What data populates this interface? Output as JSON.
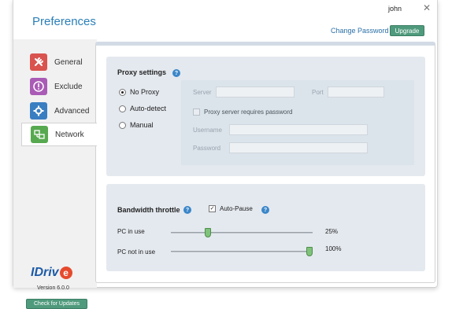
{
  "window": {
    "title": "Preferences",
    "user": "john",
    "close_glyph": "✕",
    "change_password": "Change Password",
    "upgrade": "Upgrade"
  },
  "sidebar": {
    "items": [
      {
        "label": "General",
        "icon": "wrench-icon",
        "color": "#d9534f",
        "active": false
      },
      {
        "label": "Exclude",
        "icon": "exclamation-icon",
        "color": "#a95bb5",
        "active": false
      },
      {
        "label": "Advanced",
        "icon": "gear-icon",
        "color": "#3a7ec2",
        "active": false
      },
      {
        "label": "Network",
        "icon": "network-icon",
        "color": "#57a94f",
        "active": true
      }
    ],
    "brand": "IDriv",
    "brand_e": "e",
    "version": "Version 6.0.0",
    "check_updates": "Check for Updates"
  },
  "proxy": {
    "title": "Proxy settings",
    "help": "?",
    "options": [
      "No Proxy",
      "Auto-detect",
      "Manual"
    ],
    "selected": "No Proxy",
    "server_label": "Server",
    "server_value": "",
    "port_label": "Port",
    "port_value": "",
    "requires_password_label": "Proxy server requires password",
    "username_label": "Username",
    "username_value": "",
    "password_label": "Password",
    "password_value": ""
  },
  "bandwidth": {
    "title": "Bandwidth throttle",
    "help": "?",
    "auto_pause_label": "Auto-Pause",
    "auto_pause_checked": true,
    "pc_in_use_label": "PC in use",
    "pc_in_use_value": "25%",
    "pc_in_use_level": 0.25,
    "pc_not_in_use_label": "PC not in use",
    "pc_not_in_use_value": "100%",
    "pc_not_in_use_level": 1.0
  },
  "colors": {
    "accent": "#2a7fb8",
    "button": "#4f9a7d"
  }
}
